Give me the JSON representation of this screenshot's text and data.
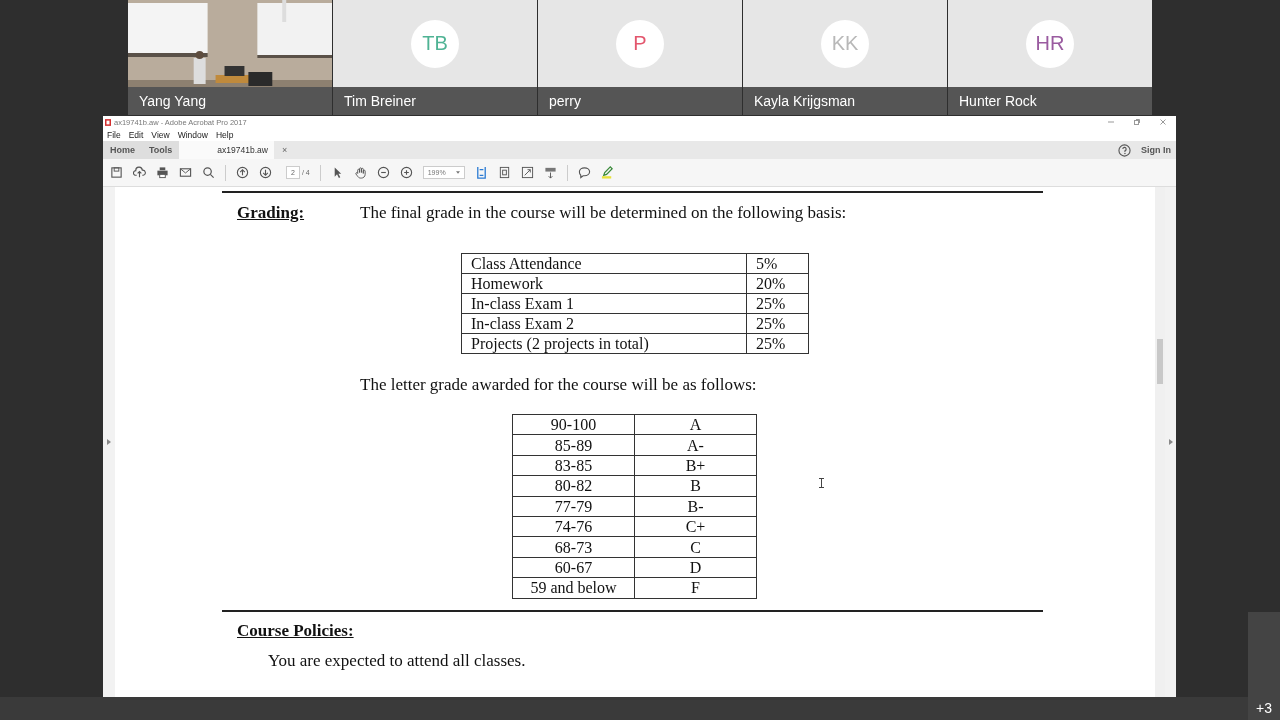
{
  "participants": [
    {
      "name": "Yang Yang",
      "kind": "video"
    },
    {
      "name": "Tim Breiner",
      "kind": "avatar",
      "initials": "TB",
      "color": "#4fb394"
    },
    {
      "name": "perry",
      "kind": "avatar",
      "initials": "P",
      "color": "#e3566d"
    },
    {
      "name": "Kayla Krijgsman",
      "kind": "avatar",
      "initials": "KK",
      "color": "#b8b8b8"
    },
    {
      "name": "Hunter Rock",
      "kind": "avatar",
      "initials": "HR",
      "color": "#9a5ba0"
    }
  ],
  "overflow_count": "+3",
  "acrobat": {
    "title": "ax19741b.aw - Adobe Acrobat Pro 2017",
    "menu": [
      "File",
      "Edit",
      "View",
      "Window",
      "Help"
    ],
    "tabs": [
      {
        "label": "Home",
        "selected": false
      },
      {
        "label": "Tools",
        "selected": false
      },
      {
        "label": "ax19741b.aw",
        "selected": true
      }
    ],
    "tab_close": "×",
    "sign_in": "Sign In",
    "page_number": "2",
    "page_count": "/ 4",
    "zoom": "199%"
  },
  "document": {
    "grading_heading": "Grading:",
    "grading_intro": "The final grade in the course will be determined on the following basis:",
    "weights": [
      {
        "item": "Class Attendance",
        "percent": "5%"
      },
      {
        "item": "Homework",
        "percent": "20%"
      },
      {
        "item": "In-class Exam 1",
        "percent": "25%"
      },
      {
        "item": "In-class Exam 2",
        "percent": "25%"
      },
      {
        "item": "Projects (2 projects in total)",
        "percent": "25%"
      }
    ],
    "letter_intro": "The letter grade awarded for the course will be as follows:",
    "letters": [
      {
        "range": "90-100",
        "grade": "A"
      },
      {
        "range": "85-89",
        "grade": "A-"
      },
      {
        "range": "83-85",
        "grade": "B+"
      },
      {
        "range": "80-82",
        "grade": "B"
      },
      {
        "range": "77-79",
        "grade": "B-"
      },
      {
        "range": "74-76",
        "grade": "C+"
      },
      {
        "range": "68-73",
        "grade": "C"
      },
      {
        "range": "60-67",
        "grade": "D"
      },
      {
        "range": "59 and below",
        "grade": "F"
      }
    ],
    "policies_heading": "Course Policies:",
    "policy_text": "You are expected to attend all classes."
  }
}
